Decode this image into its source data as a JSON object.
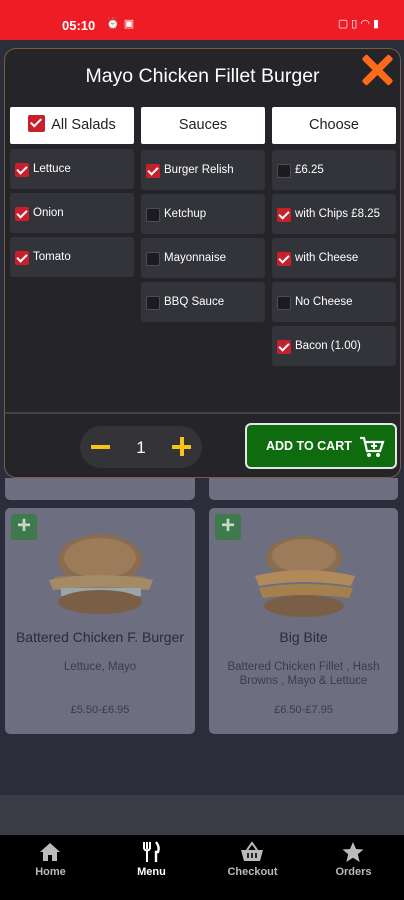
{
  "status_bar": {
    "time": "05:10",
    "left_icons": [
      "alarm-icon",
      "usb-icon"
    ],
    "right_icons": [
      "nfc-icon",
      "vibrate-icon",
      "wifi-icon",
      "battery-icon"
    ]
  },
  "modal": {
    "title": "Mayo Chicken Fillet Burger",
    "columns": [
      {
        "header": "All Salads",
        "header_checked": true,
        "options": [
          {
            "label": "Lettuce",
            "checked": true
          },
          {
            "label": "Onion",
            "checked": true
          },
          {
            "label": "Tomato",
            "checked": true
          }
        ]
      },
      {
        "header": "Sauces",
        "options": [
          {
            "label": "Burger Relish",
            "checked": true
          },
          {
            "label": "Ketchup",
            "checked": false
          },
          {
            "label": "Mayonnaise",
            "checked": false
          },
          {
            "label": "BBQ Sauce",
            "checked": false
          }
        ]
      },
      {
        "header": "Choose",
        "options": [
          {
            "label": "£6.25",
            "checked": false
          },
          {
            "label": "with Chips £8.25",
            "checked": true
          },
          {
            "label": "with Cheese",
            "checked": true
          },
          {
            "label": "No Cheese",
            "checked": false
          },
          {
            "label": "Bacon (1.00)",
            "checked": true
          }
        ]
      }
    ],
    "quantity": "1",
    "add_to_cart_label": "ADD TO CART",
    "colors": {
      "accent_close": "#ff6a1a",
      "checkbox": "#c81f2c",
      "add_button": "#0e6b0e",
      "qty_icons": "#f5c518"
    }
  },
  "menu_cards": [
    {
      "name": "Battered Chicken F. Burger",
      "description": "Lettuce, Mayo",
      "price": "£5.50-£6.95"
    },
    {
      "name": "Big Bite",
      "description": "Battered Chicken Fillet , Hash Browns , Mayo & Lettuce",
      "price": "£6.50-£7.95"
    }
  ],
  "bottom_nav": [
    {
      "label": "Home",
      "icon": "home-icon",
      "active": false
    },
    {
      "label": "Menu",
      "icon": "fork-knife-icon",
      "active": true
    },
    {
      "label": "Checkout",
      "icon": "basket-icon",
      "active": false
    },
    {
      "label": "Orders",
      "icon": "star-icon",
      "active": false
    }
  ]
}
